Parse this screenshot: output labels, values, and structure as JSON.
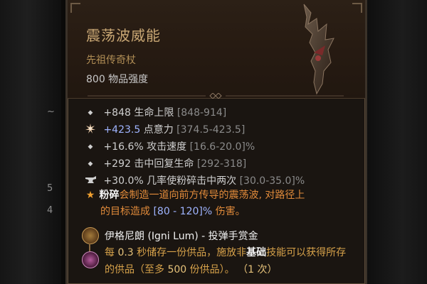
{
  "item": {
    "name": "震荡波威能",
    "type": "先祖传奇杖",
    "power": "800 物品强度",
    "colors": {
      "name": "#c9a774",
      "type": "#b08d55",
      "legendary": "#e08a3a",
      "range": "#9fb4ff"
    }
  },
  "stats": [
    {
      "icon": "diamond-bullet",
      "value": "+848",
      "label": "生命上限",
      "range": "[848-914]"
    },
    {
      "icon": "burst-icon",
      "value": "+423.5",
      "label": "点意力",
      "range": "[374.5-423.5]"
    },
    {
      "icon": "diamond-bullet",
      "value": "+16.6%",
      "label": "攻击速度",
      "range": "[16.6-20.0]%"
    },
    {
      "icon": "diamond-bullet",
      "value": "+292",
      "label": "击中回复生命",
      "range": "[292-318]"
    },
    {
      "icon": "anvil-icon",
      "value": "+30.0%",
      "label": "几率使粉碎击中两次",
      "range": "[30.0-35.0]%"
    }
  ],
  "legendary_power": {
    "keyword": "粉碎",
    "text1": "会制造一道向前方传导的震荡波, 对路径上",
    "text2_prefix": "的目标造成",
    "range": "[80 - 120]%",
    "text2_suffix": "伤害。"
  },
  "aspect": {
    "title": "伊格尼朗 (Igni Lum) - 投弹手赏金",
    "desc_pre": "每",
    "num1": "0.3",
    "desc_mid1": "秒储存一份供品，施放非",
    "kw": "基础",
    "desc_mid2": "技能可以获得所存的供品（至多",
    "num2": "500",
    "desc_end": "份供品）。",
    "paren": "（1 次）"
  },
  "edge_glyphs": [
    "⋯",
    "⋯",
    "⋯"
  ]
}
